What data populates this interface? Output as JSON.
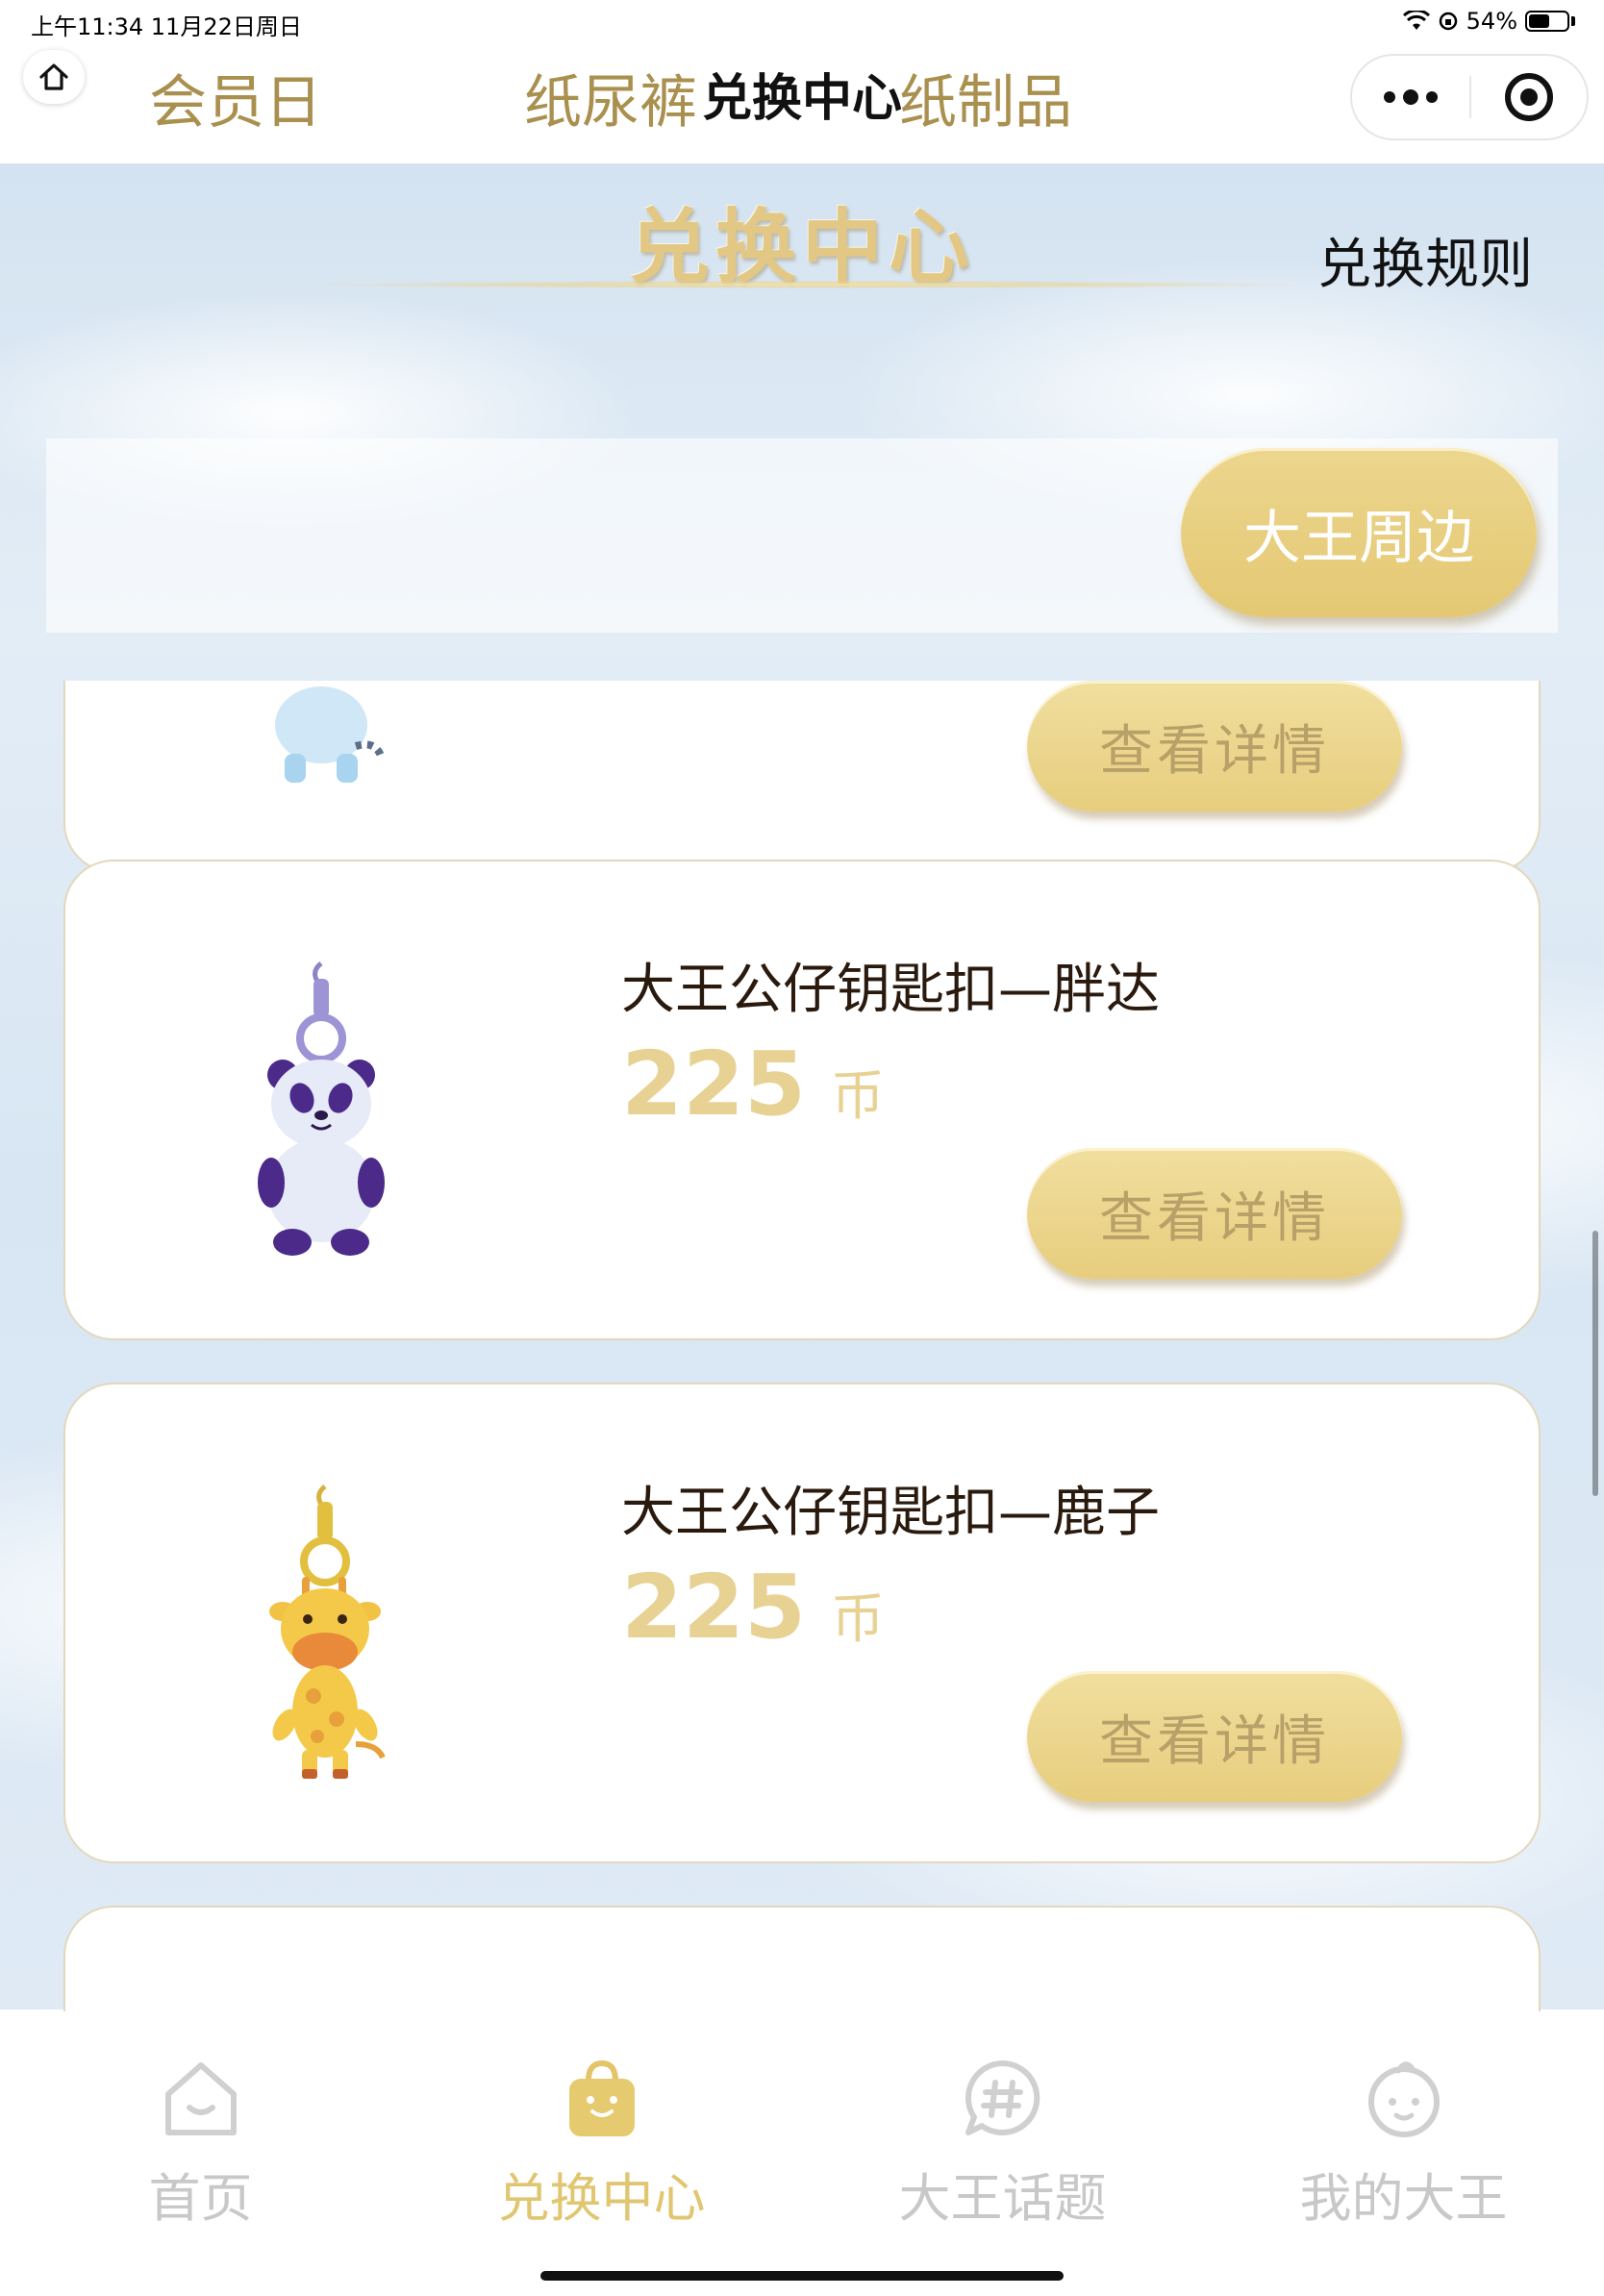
{
  "status_bar": {
    "time": "上午11:34   11月22日周日",
    "battery_pct": "54%",
    "battery_level": 0.54
  },
  "nav": {
    "title": "兑换中心"
  },
  "banner": {
    "title": "兑换中心",
    "rules_link": "兑换规则"
  },
  "tabs": [
    {
      "label": "会员日",
      "active": false
    },
    {
      "label": "纸尿裤",
      "active": false
    },
    {
      "label": "纸制品",
      "active": false
    },
    {
      "label": "大王周边",
      "active": true
    }
  ],
  "products": [
    {
      "name": "",
      "price": "",
      "unit": "",
      "button": "查看详情",
      "image": "tiger-keychain"
    },
    {
      "name": "大王公仔钥匙扣—胖达",
      "price": "225",
      "unit": "币",
      "button": "查看详情",
      "image": "panda-keychain"
    },
    {
      "name": "大王公仔钥匙扣—鹿子",
      "price": "225",
      "unit": "币",
      "button": "查看详情",
      "image": "giraffe-keychain"
    }
  ],
  "bottom_tabs": [
    {
      "label": "首页",
      "icon": "home-icon",
      "active": false
    },
    {
      "label": "兑换中心",
      "icon": "shopping-bag-icon",
      "active": true
    },
    {
      "label": "大王话题",
      "icon": "hashtag-icon",
      "active": false
    },
    {
      "label": "我的大王",
      "icon": "baby-face-icon",
      "active": false
    }
  ],
  "colors": {
    "gold": "#e4c873",
    "gold_text": "#a9904e",
    "price": "#e8d293",
    "inactive": "#c8c8c8"
  }
}
